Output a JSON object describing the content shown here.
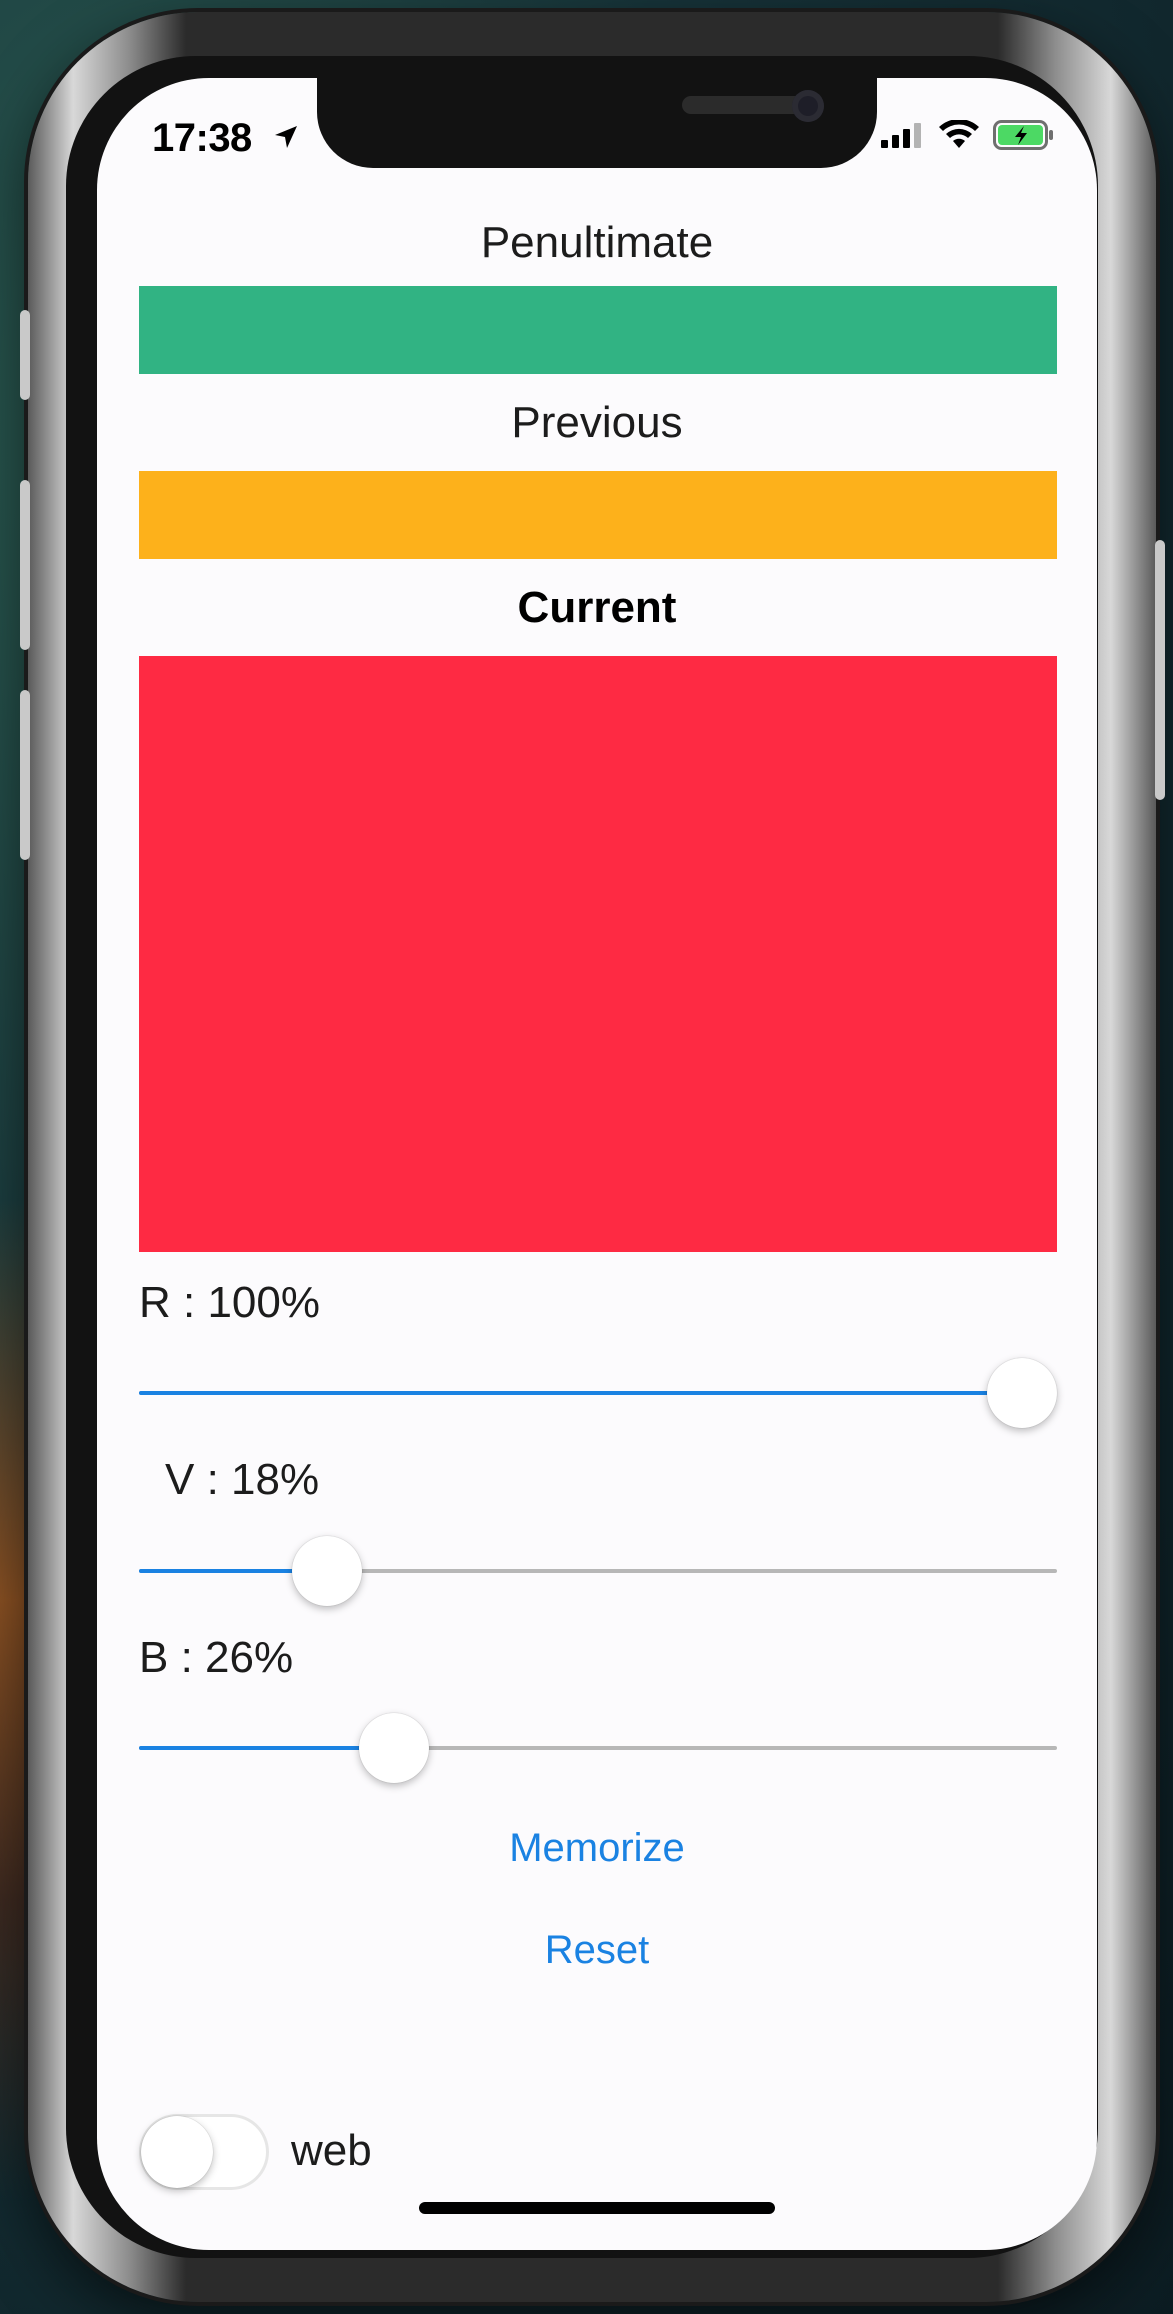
{
  "status_bar": {
    "time": "17:38"
  },
  "swatches": {
    "penultimate": {
      "label": "Penultimate",
      "color": "#31b383"
    },
    "previous": {
      "label": "Previous",
      "color": "#fdb11b"
    },
    "current": {
      "label": "Current",
      "color": "#fe2a43"
    }
  },
  "sliders": {
    "r": {
      "label": "R : 100%",
      "value": 1.0,
      "color": "#1a82e2"
    },
    "v": {
      "label": "V : 18%",
      "value": 0.18,
      "color": "#1a82e2"
    },
    "b": {
      "label": "B : 26%",
      "value": 0.26,
      "color": "#1a82e2"
    }
  },
  "actions": {
    "memorize": "Memorize",
    "reset": "Reset"
  },
  "toggle": {
    "label": "web",
    "on": false
  }
}
